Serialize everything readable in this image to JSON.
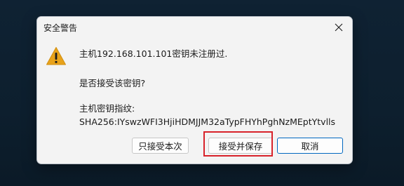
{
  "dialog": {
    "title": "安全警告",
    "icon": "warning-icon",
    "message_host": "主机192.168.101.101密钥未注册过.",
    "question": "是否接受该密钥?",
    "fingerprint_label": "主机密钥指纹:",
    "fingerprint_value": "SHA256:IYswzWFI3HjiHDMJJM32aTypFHYhPghNzMEptYtvlls"
  },
  "buttons": {
    "accept_once": "只接受本次",
    "accept_and_save": "接受并保存",
    "cancel": "取消"
  },
  "colors": {
    "warning": "#e8a21a",
    "highlight": "#d8222a",
    "focus_border": "#0067c0"
  }
}
